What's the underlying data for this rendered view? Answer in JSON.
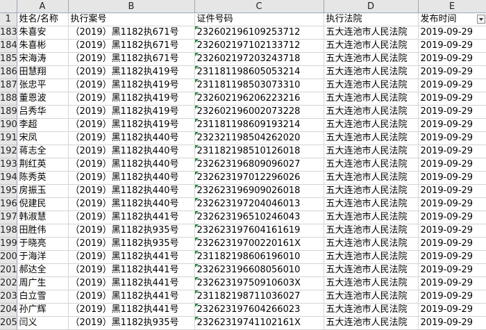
{
  "columns": [
    "A",
    "B",
    "C",
    "D",
    "E"
  ],
  "header_row": {
    "num": "1",
    "cells": [
      "姓名/名称",
      "执行案号",
      "证件号码",
      "执行法院",
      "发布时间"
    ]
  },
  "rows": [
    {
      "num": "183",
      "cells": [
        "朱喜安",
        "（2019）黑1182执671号",
        "232602196109253712",
        "五大连池市人民法院",
        "2019-09-29"
      ]
    },
    {
      "num": "184",
      "cells": [
        "朱喜彬",
        "（2019）黑1182执671号",
        "232602197102133712",
        "五大连池市人民法院",
        "2019-09-29"
      ]
    },
    {
      "num": "185",
      "cells": [
        "宋海涛",
        "（2019）黑1182执671号",
        "232602197203243718",
        "五大连池市人民法院",
        "2019-09-29"
      ]
    },
    {
      "num": "186",
      "cells": [
        "田慧翔",
        "（2019）黑1182执419号",
        "231181198605053214",
        "五大连池市人民法院",
        "2019-09-29"
      ]
    },
    {
      "num": "187",
      "cells": [
        "张忠平",
        "（2019）黑1182执419号",
        "231181198503073310",
        "五大连池市人民法院",
        "2019-09-29"
      ]
    },
    {
      "num": "188",
      "cells": [
        "董恩波",
        "（2019）黑1182执419号",
        "232602196206223216",
        "五大连池市人民法院",
        "2019-09-29"
      ]
    },
    {
      "num": "189",
      "cells": [
        "吕秀华",
        "（2019）黑1182执419号",
        "232602196002073228",
        "五大连池市人民法院",
        "2019-09-29"
      ]
    },
    {
      "num": "190",
      "cells": [
        "李超",
        "（2019）黑1182执419号",
        "231181198609193214",
        "五大连池市人民法院",
        "2019-09-29"
      ]
    },
    {
      "num": "191",
      "cells": [
        "宋凤",
        "（2019）黑1182执440号",
        "232321198504262020",
        "五大连池市人民法院",
        "2019-09-29"
      ]
    },
    {
      "num": "192",
      "cells": [
        "蒋志全",
        "（2019）黑1182执440号",
        "231182198510126018",
        "五大连池市人民法院",
        "2019-09-29"
      ]
    },
    {
      "num": "193",
      "cells": [
        "荆红英",
        "（2019）黑1182执440号",
        "232623196809096027",
        "五大连池市人民法院",
        "2019-09-29"
      ]
    },
    {
      "num": "194",
      "cells": [
        "陈秀英",
        "（2019）黑1182执440号",
        "232623197012296026",
        "五大连池市人民法院",
        "2019-09-29"
      ]
    },
    {
      "num": "195",
      "cells": [
        "房振玉",
        "（2019）黑1182执440号",
        "232623196909026018",
        "五大连池市人民法院",
        "2019-09-29"
      ]
    },
    {
      "num": "196",
      "cells": [
        "倪建民",
        "（2019）黑1182执440号",
        "232623197204046013",
        "五大连池市人民法院",
        "2019-09-29"
      ]
    },
    {
      "num": "197",
      "cells": [
        "韩淑慧",
        "（2019）黑1182执441号",
        "232623196510246043",
        "五大连池市人民法院",
        "2019-09-29"
      ]
    },
    {
      "num": "198",
      "cells": [
        "田胜伟",
        "（2019）黑1182执935号",
        "232623197604161619",
        "五大连池市人民法院",
        "2019-09-29"
      ]
    },
    {
      "num": "199",
      "cells": [
        "于晓亮",
        "（2019）黑1182执935号",
        "23262319700220161X",
        "五大连池市人民法院",
        "2019-09-29"
      ]
    },
    {
      "num": "200",
      "cells": [
        "于海洋",
        "（2019）黑1182执441号",
        "231182198606196010",
        "五大连池市人民法院",
        "2019-09-29"
      ]
    },
    {
      "num": "201",
      "cells": [
        "郝达全",
        "（2019）黑1182执441号",
        "232623196608056010",
        "五大连池市人民法院",
        "2019-09-29"
      ]
    },
    {
      "num": "202",
      "cells": [
        "周广生",
        "（2019）黑1182执441号",
        "23262319750910603X",
        "五大连池市人民法院",
        "2019-09-29"
      ]
    },
    {
      "num": "203",
      "cells": [
        "白立雪",
        "（2019）黑1182执441号",
        "231182198711036027",
        "五大连池市人民法院",
        "2019-09-29"
      ]
    },
    {
      "num": "204",
      "cells": [
        "孙广辉",
        "（2019）黑1182执441号",
        "232623197604266023",
        "五大连池市人民法院",
        "2019-09-29"
      ]
    },
    {
      "num": "205",
      "cells": [
        "闫义",
        "（2019）黑1182执935号",
        "23262319741102161X",
        "五大连池市人民法院",
        "2019-09-29"
      ]
    }
  ],
  "colors": {
    "header_bg": "#e6e6e6",
    "grid": "#d4d4d4",
    "error_marker": "#1a8a3a"
  },
  "icons": {
    "filter": "filter-dropdown-icon"
  }
}
